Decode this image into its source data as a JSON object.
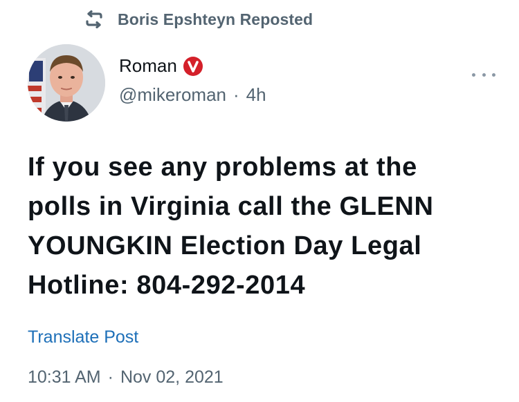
{
  "repost": {
    "icon": "repost-icon",
    "text": "Boris Epshteyn Reposted"
  },
  "author": {
    "display_name": "Roman",
    "badge_icon": "verified-badge-icon",
    "badge_color": "#d4202a",
    "handle": "@mikeroman",
    "separator": "·",
    "time_ago": "4h"
  },
  "tweet": {
    "text": "If you see any problems at the\npolls in Virginia call the GLENN\nYOUNGKIN Election Day Legal\nHotline: 804-292-2014"
  },
  "actions": {
    "more_icon": "more-icon",
    "translate_label": "Translate Post"
  },
  "meta": {
    "time": "10:31 AM",
    "separator": "·",
    "date": "Nov 02, 2021"
  },
  "colors": {
    "text_primary": "#0f1419",
    "text_secondary": "#536471",
    "link": "#1d6fb8"
  }
}
